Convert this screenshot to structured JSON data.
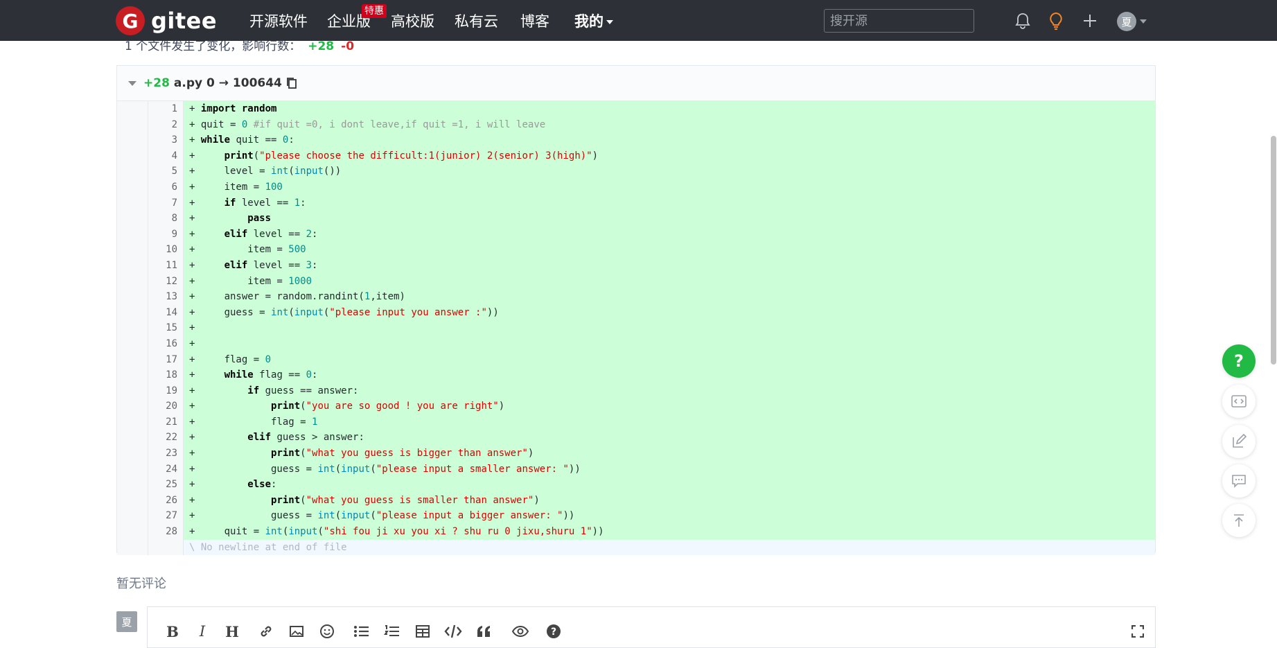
{
  "navbar": {
    "logo_text": "gitee",
    "logo_letter": "G",
    "items": [
      "开源软件",
      "企业版",
      "高校版",
      "私有云",
      "博客",
      "我的"
    ],
    "enterprise_badge": "特惠",
    "search_placeholder": "搜开源",
    "avatar_text": "夏",
    "icons": [
      "bell-icon",
      "lightbulb-icon",
      "plus-icon"
    ]
  },
  "summary": {
    "text": "1 个文件发生了变化，影响行数：",
    "additions": "+28",
    "deletions": "-0"
  },
  "diff": {
    "header_additions": "+28",
    "file_info": "a.py 0 → 100644",
    "lines": [
      {
        "n": "1",
        "html": "+ <span class='kw'>import</span> <span class='kw'>random</span>"
      },
      {
        "n": "2",
        "html": "+ quit = <span class='num'>0</span> <span class='cm'>#if quit =0, i dont leave,if quit =1, i will leave</span>"
      },
      {
        "n": "3",
        "html": "+ <span class='kw'>while</span> quit == <span class='num'>0</span>:"
      },
      {
        "n": "4",
        "html": "+     <span class='kw'>print</span>(<span class='str'>\"please choose the difficult:1(junior) 2(senior) 3(high)\"</span>)"
      },
      {
        "n": "5",
        "html": "+     level = <span class='bi'>int</span>(<span class='bi'>input</span>())"
      },
      {
        "n": "6",
        "html": "+     item = <span class='num'>100</span>"
      },
      {
        "n": "7",
        "html": "+     <span class='kw'>if</span> level == <span class='num'>1</span>:"
      },
      {
        "n": "8",
        "html": "+         <span class='kw'>pass</span>"
      },
      {
        "n": "9",
        "html": "+     <span class='kw'>elif</span> level == <span class='num'>2</span>:"
      },
      {
        "n": "10",
        "html": "+         item = <span class='num'>500</span>"
      },
      {
        "n": "11",
        "html": "+     <span class='kw'>elif</span> level == <span class='num'>3</span>:"
      },
      {
        "n": "12",
        "html": "+         item = <span class='num'>1000</span>"
      },
      {
        "n": "13",
        "html": "+     answer = random.randint(<span class='num'>1</span>,item)"
      },
      {
        "n": "14",
        "html": "+     guess = <span class='bi'>int</span>(<span class='bi'>input</span>(<span class='str'>\"please input you answer :\"</span>))"
      },
      {
        "n": "15",
        "html": "+"
      },
      {
        "n": "16",
        "html": "+"
      },
      {
        "n": "17",
        "html": "+     flag = <span class='num'>0</span>"
      },
      {
        "n": "18",
        "html": "+     <span class='kw'>while</span> flag == <span class='num'>0</span>:"
      },
      {
        "n": "19",
        "html": "+         <span class='kw'>if</span> guess == answer:"
      },
      {
        "n": "20",
        "html": "+             <span class='kw'>print</span>(<span class='str'>\"you are so good ! you are right\"</span>)"
      },
      {
        "n": "21",
        "html": "+             flag = <span class='num'>1</span>"
      },
      {
        "n": "22",
        "html": "+         <span class='kw'>elif</span> guess > answer:"
      },
      {
        "n": "23",
        "html": "+             <span class='kw'>print</span>(<span class='str'>\"what you guess is bigger than answer\"</span>)"
      },
      {
        "n": "24",
        "html": "+             guess = <span class='bi'>int</span>(<span class='bi'>input</span>(<span class='str'>\"please input a smaller answer: \"</span>))"
      },
      {
        "n": "25",
        "html": "+         <span class='kw'>else</span>:"
      },
      {
        "n": "26",
        "html": "+             <span class='kw'>print</span>(<span class='str'>\"what you guess is smaller than answer\"</span>)"
      },
      {
        "n": "27",
        "html": "+             guess = <span class='bi'>int</span>(<span class='bi'>input</span>(<span class='str'>\"please input a bigger answer: \"</span>))"
      },
      {
        "n": "28",
        "html": "+     quit = <span class='bi'>int</span>(<span class='bi'>input</span>(<span class='str'>\"shi fou ji xu you xi ? shu ru 0 jixu,shuru 1\"</span>))"
      }
    ],
    "no_newline": "\\ No newline at end of file"
  },
  "comments": {
    "empty_text": "暂无评论",
    "avatar_text": "夏",
    "toolbar": [
      "bold-icon",
      "italic-icon",
      "heading-icon",
      "link-icon",
      "image-icon",
      "emoji-icon",
      "bullet-list-icon",
      "ordered-list-icon",
      "table-icon",
      "code-icon",
      "quote-icon",
      "preview-eye-icon",
      "help-icon",
      "fullscreen-icon"
    ],
    "toolbar_labels": {
      "bold": "B",
      "italic": "I",
      "heading": "H"
    }
  },
  "floating": {
    "help_label": "?",
    "icons": [
      "help-icon",
      "code-review-icon",
      "edit-icon",
      "comment-icon",
      "back-to-top-icon"
    ]
  },
  "colors": {
    "navbar_bg": "#2d3137",
    "brand_red": "#c71d23",
    "added_line_bg": "#ccffd8",
    "help_green": "#21ba45"
  }
}
